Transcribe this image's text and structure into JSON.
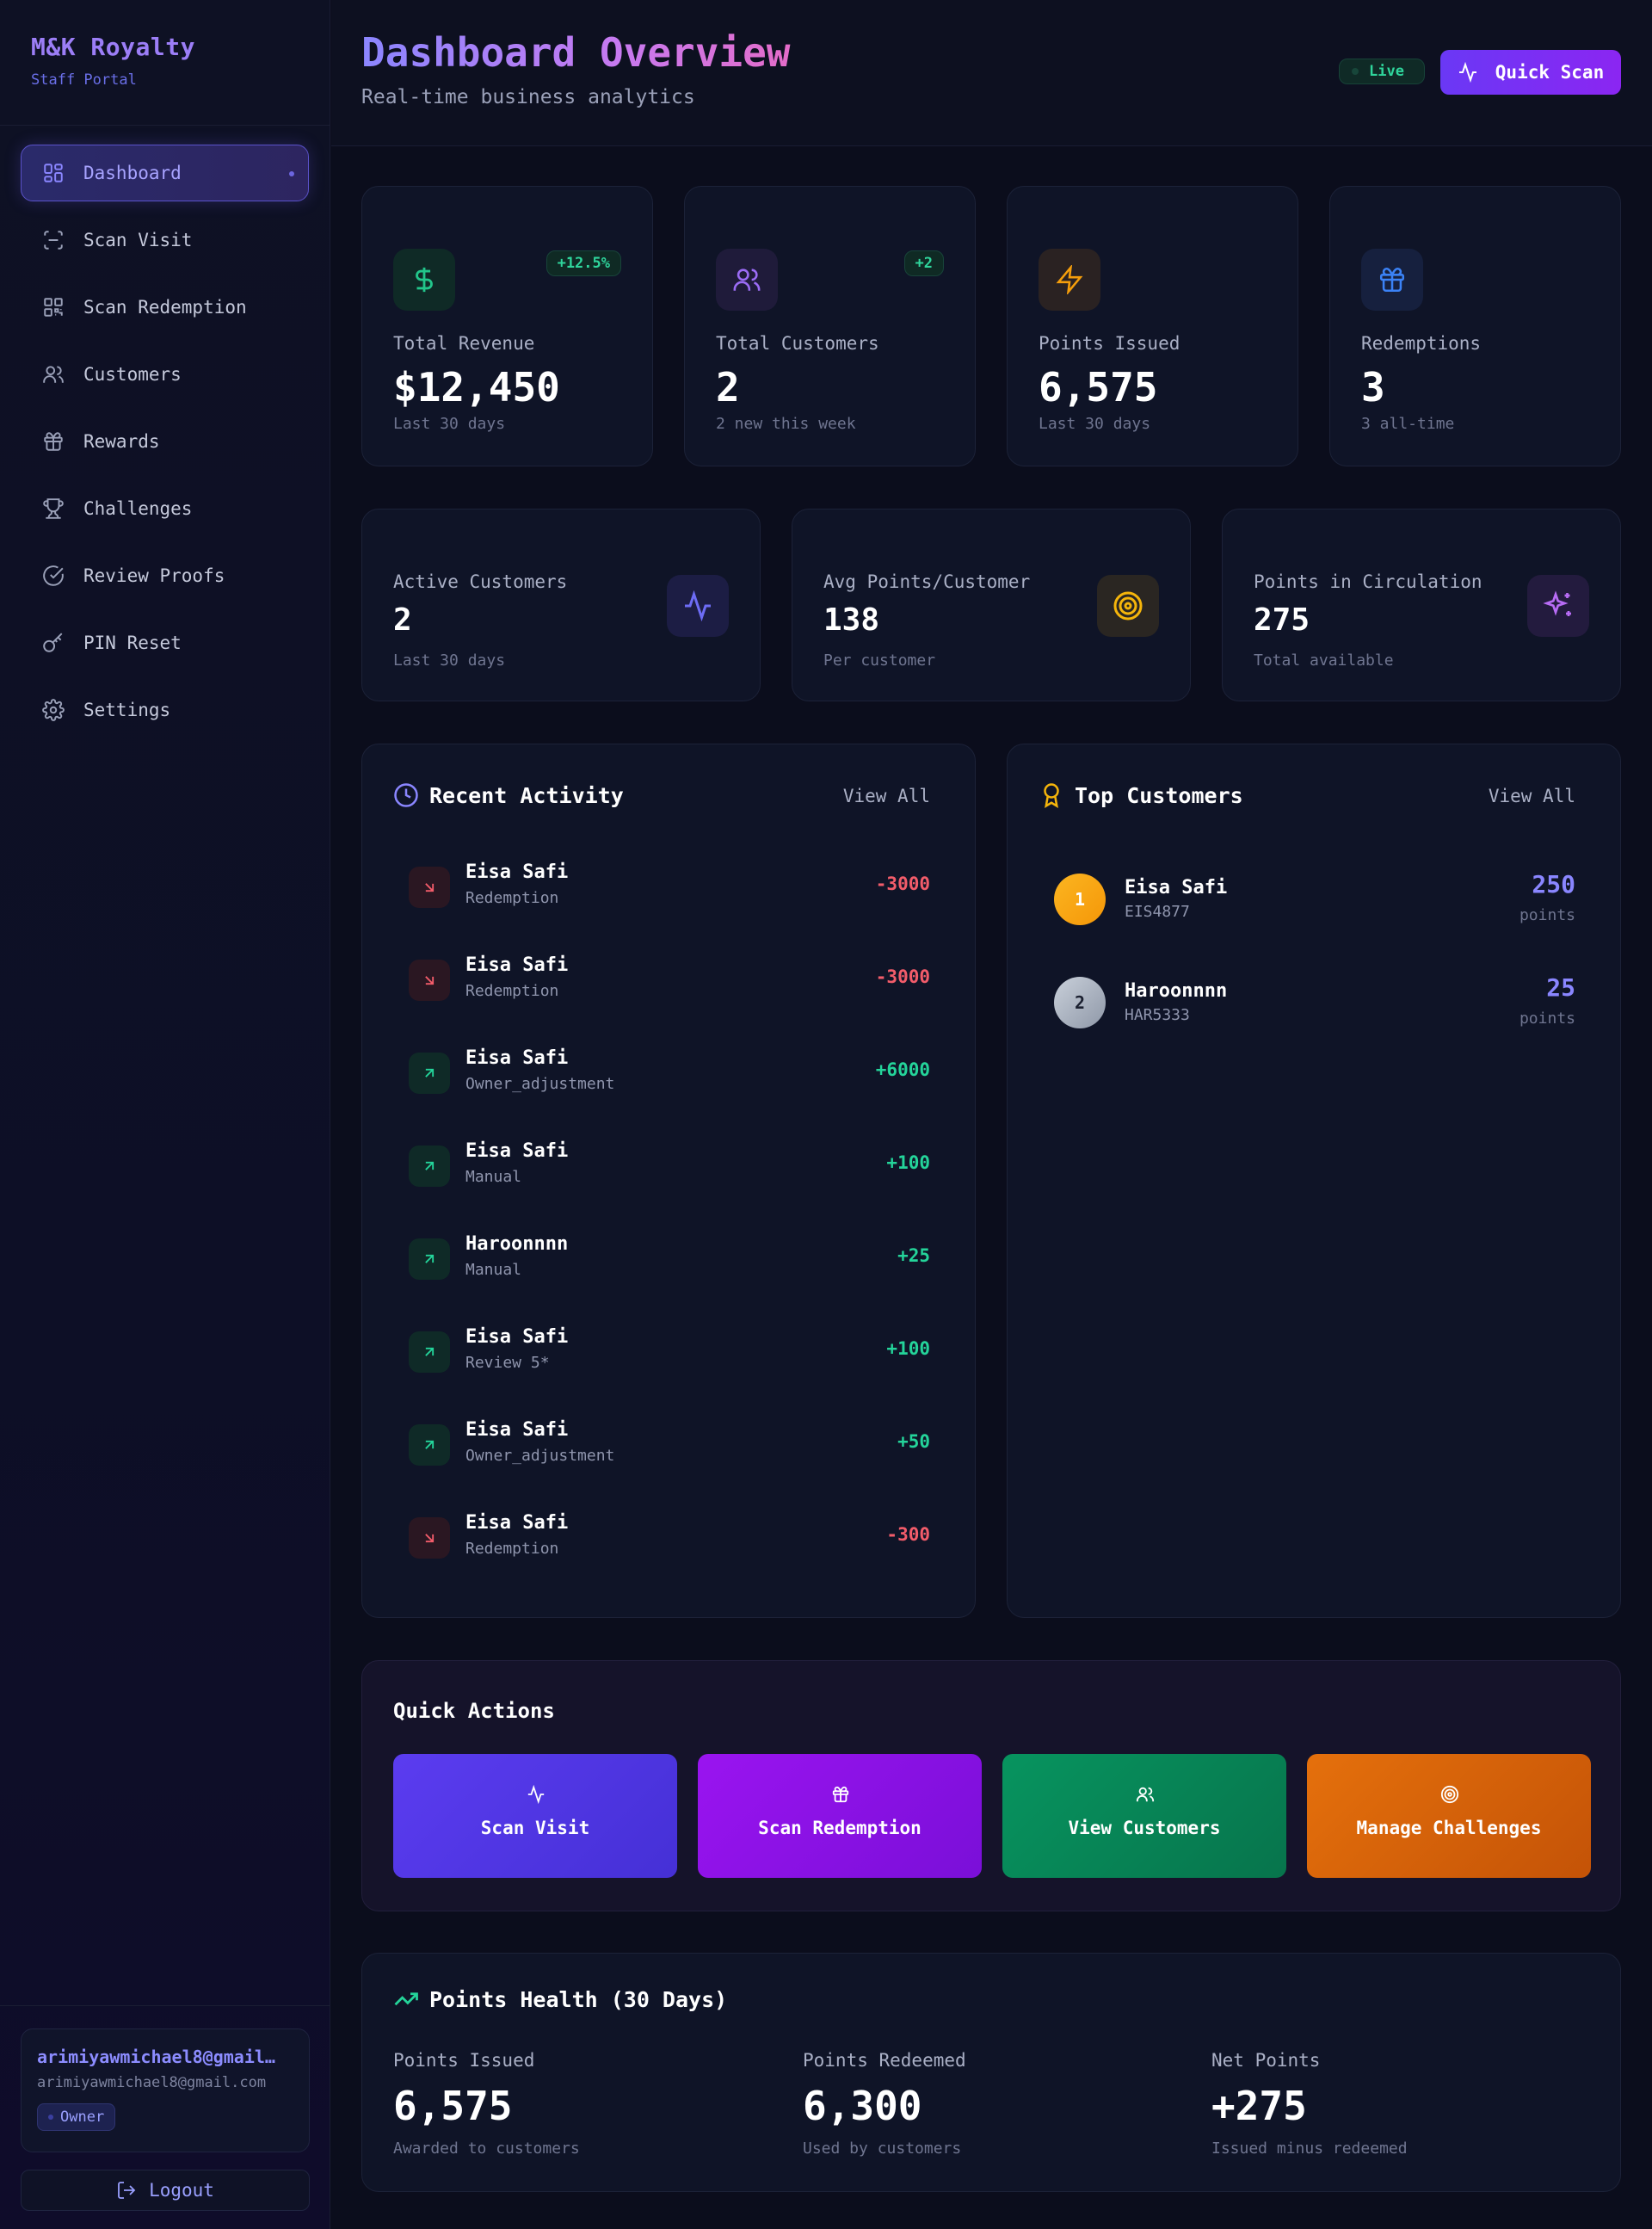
{
  "brand": {
    "title": "M&K Royalty",
    "subtitle": "Staff Portal"
  },
  "sidebar": {
    "items": [
      {
        "label": "Dashboard",
        "icon": "dashboard-icon",
        "active": true
      },
      {
        "label": "Scan Visit",
        "icon": "scan-icon"
      },
      {
        "label": "Scan Redemption",
        "icon": "qr-code-icon"
      },
      {
        "label": "Customers",
        "icon": "users-icon"
      },
      {
        "label": "Rewards",
        "icon": "gift-icon"
      },
      {
        "label": "Challenges",
        "icon": "trophy-icon"
      },
      {
        "label": "Review Proofs",
        "icon": "check-circle-icon"
      },
      {
        "label": "PIN Reset",
        "icon": "key-icon"
      },
      {
        "label": "Settings",
        "icon": "gear-icon"
      }
    ]
  },
  "user": {
    "name": "arimiyawmichael8@gmail…",
    "email": "arimiyawmichael8@gmail.com",
    "role": "Owner",
    "logout_label": "Logout"
  },
  "header": {
    "title": "Dashboard Overview",
    "subtitle": "Real-time business analytics",
    "live_label": "Live",
    "quick_scan_label": "Quick Scan"
  },
  "stats": [
    {
      "label": "Total Revenue",
      "value": "$12,450",
      "note": "Last 30 days",
      "badge": "+12.5%",
      "icon": "dollar-icon",
      "color": "#22c58a"
    },
    {
      "label": "Total Customers",
      "value": "2",
      "note": "2 new this week",
      "badge": "+2",
      "icon": "users-icon",
      "color": "#9b6cf5"
    },
    {
      "label": "Points Issued",
      "value": "6,575",
      "note": "Last 30 days",
      "badge": "",
      "icon": "lightning-icon",
      "color": "#f59e0b"
    },
    {
      "label": "Redemptions",
      "value": "3",
      "note": "3 all-time",
      "badge": "",
      "icon": "gift-icon",
      "color": "#3b82f6"
    }
  ],
  "metrics": [
    {
      "label": "Active Customers",
      "value": "2",
      "note": "Last 30 days",
      "icon": "activity-icon",
      "color": "#6d6cf5"
    },
    {
      "label": "Avg Points/Customer",
      "value": "138",
      "note": "Per customer",
      "icon": "target-icon",
      "color": "#f5b50b"
    },
    {
      "label": "Points in Circulation",
      "value": "275",
      "note": "Total available",
      "icon": "sparkle-icon",
      "color": "#b86cf5"
    }
  ],
  "recent_activity": {
    "title": "Recent Activity",
    "view_all": "View All",
    "rows": [
      {
        "name": "Eisa Safi",
        "type": "Redemption",
        "amount": "-3000",
        "dir": "neg"
      },
      {
        "name": "Eisa Safi",
        "type": "Redemption",
        "amount": "-3000",
        "dir": "neg"
      },
      {
        "name": "Eisa Safi",
        "type": "Owner_adjustment",
        "amount": "+6000",
        "dir": "pos"
      },
      {
        "name": "Eisa Safi",
        "type": "Manual",
        "amount": "+100",
        "dir": "pos"
      },
      {
        "name": "Haroonnnn",
        "type": "Manual",
        "amount": "+25",
        "dir": "pos"
      },
      {
        "name": "Eisa Safi",
        "type": "Review 5*",
        "amount": "+100",
        "dir": "pos"
      },
      {
        "name": "Eisa Safi",
        "type": "Owner_adjustment",
        "amount": "+50",
        "dir": "pos"
      },
      {
        "name": "Eisa Safi",
        "type": "Redemption",
        "amount": "-300",
        "dir": "neg"
      }
    ]
  },
  "top_customers": {
    "title": "Top Customers",
    "view_all": "View All",
    "rows": [
      {
        "rank": "1",
        "name": "Eisa Safi",
        "code": "EIS4877",
        "points": "250",
        "unit": "points",
        "medal": "gold"
      },
      {
        "rank": "2",
        "name": "Haroonnnn",
        "code": "HAR5333",
        "points": "25",
        "unit": "points",
        "medal": "silver"
      }
    ]
  },
  "quick_actions": {
    "title": "Quick Actions",
    "buttons": [
      {
        "label": "Scan Visit",
        "icon": "activity-icon",
        "gradient": [
          "#5b3cf0",
          "#4530d6"
        ]
      },
      {
        "label": "Scan Redemption",
        "icon": "gift-icon",
        "gradient": [
          "#9a14f0",
          "#7a0fd8"
        ]
      },
      {
        "label": "View Customers",
        "icon": "users-icon",
        "gradient": [
          "#07945f",
          "#07744c"
        ]
      },
      {
        "label": "Manage Challenges",
        "icon": "target-icon",
        "gradient": [
          "#e5700c",
          "#c45307"
        ]
      }
    ]
  },
  "points_health": {
    "title": "Points Health (30 Days)",
    "cols": [
      {
        "label": "Points Issued",
        "value": "6,575",
        "note": "Awarded to customers"
      },
      {
        "label": "Points Redeemed",
        "value": "6,300",
        "note": "Used by customers"
      },
      {
        "label": "Net Points",
        "value": "+275",
        "note": "Issued minus redeemed"
      }
    ]
  }
}
